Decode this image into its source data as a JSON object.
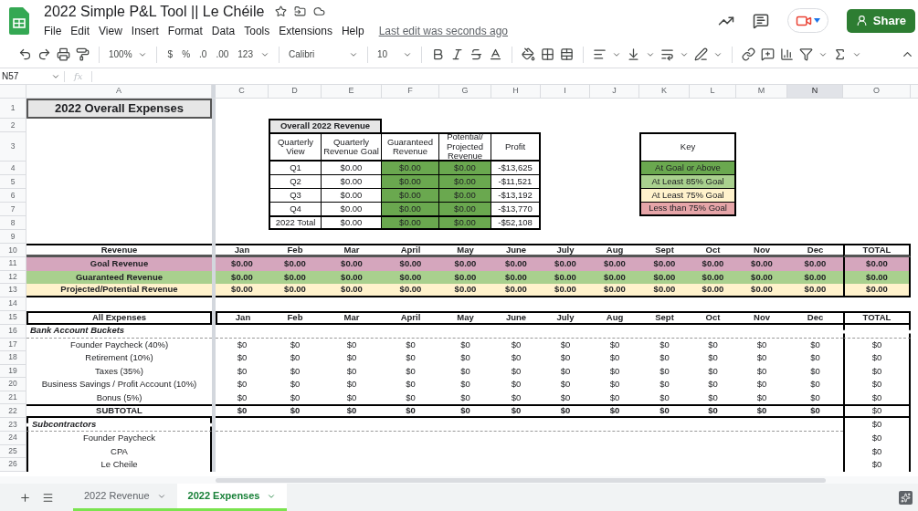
{
  "app": {
    "title": "2022 Simple P&L Tool || Le Chéile",
    "menu": [
      "File",
      "Edit",
      "View",
      "Insert",
      "Format",
      "Data",
      "Tools",
      "Extensions",
      "Help"
    ],
    "last_edit": "Last edit was seconds ago",
    "share": "Share"
  },
  "toolbar": {
    "zoom": "100%",
    "number_formats": [
      "$",
      "%",
      ".0",
      ".00",
      "123"
    ],
    "font": "Calibri",
    "font_size": "10"
  },
  "formula_bar": {
    "name_box": "N57",
    "fx": "fx"
  },
  "column_headers": [
    {
      "label": "A",
      "selected": false
    },
    {
      "label": "C",
      "selected": false
    },
    {
      "label": "D",
      "selected": false
    },
    {
      "label": "E",
      "selected": false
    },
    {
      "label": "F",
      "selected": false
    },
    {
      "label": "G",
      "selected": false
    },
    {
      "label": "H",
      "selected": false
    },
    {
      "label": "I",
      "selected": false
    },
    {
      "label": "J",
      "selected": false
    },
    {
      "label": "K",
      "selected": false
    },
    {
      "label": "L",
      "selected": false
    },
    {
      "label": "M",
      "selected": false
    },
    {
      "label": "N",
      "selected": true
    },
    {
      "label": "O",
      "selected": false
    }
  ],
  "row_numbers": [
    "1",
    "2",
    "3",
    "4",
    "5",
    "6",
    "7",
    "8",
    "9",
    "10",
    "11",
    "12",
    "13",
    "14",
    "15",
    "16",
    "17",
    "18",
    "19",
    "20",
    "21",
    "22",
    "23",
    "24",
    "25",
    "26"
  ],
  "sheet_title": "2022 Overall Expenses",
  "overall_revenue": {
    "title": "Overall 2022 Revenue",
    "columns": [
      {
        "label": "Quarterly View",
        "highlighted": false
      },
      {
        "label": "Quarterly Revenue Goal",
        "highlighted": false
      },
      {
        "label": "Guaranteed Revenue",
        "highlighted": true
      },
      {
        "label": "Potential/ Projected Revenue",
        "highlighted": true
      },
      {
        "label": "Profit",
        "highlighted": false
      }
    ],
    "rows": [
      [
        "Q1",
        "$0.00",
        "$0.00",
        "$0.00",
        "-$13,625"
      ],
      [
        "Q2",
        "$0.00",
        "$0.00",
        "$0.00",
        "-$11,521"
      ],
      [
        "Q3",
        "$0.00",
        "$0.00",
        "$0.00",
        "-$13,192"
      ],
      [
        "Q4",
        "$0.00",
        "$0.00",
        "$0.00",
        "-$13,770"
      ],
      [
        "2022 Total",
        "$0.00",
        "$0.00",
        "$0.00",
        "-$52,108"
      ]
    ]
  },
  "key": {
    "title": "Key",
    "items": [
      {
        "label": "At Goal or Above",
        "color": "#6aa84f"
      },
      {
        "label": "At Least 85% Goal",
        "color": "#a9d08e"
      },
      {
        "label": "At Least 75% Goal",
        "color": "#fff2cc"
      },
      {
        "label": "Less than 75% Goal",
        "color": "#e6a5a8"
      }
    ]
  },
  "revenue": {
    "label": "Revenue",
    "columns": [
      "Jan",
      "Feb",
      "Mar",
      "April",
      "May",
      "June",
      "July",
      "Aug",
      "Sept",
      "Oct",
      "Nov",
      "Dec",
      "TOTAL"
    ],
    "rows": [
      {
        "label": "Goal Revenue",
        "color": "#d5a6bd",
        "values": [
          "$0.00",
          "$0.00",
          "$0.00",
          "$0.00",
          "$0.00",
          "$0.00",
          "$0.00",
          "$0.00",
          "$0.00",
          "$0.00",
          "$0.00",
          "$0.00",
          "$0.00"
        ]
      },
      {
        "label": "Guaranteed Revenue",
        "color": "#a9d08e",
        "values": [
          "$0.00",
          "$0.00",
          "$0.00",
          "$0.00",
          "$0.00",
          "$0.00",
          "$0.00",
          "$0.00",
          "$0.00",
          "$0.00",
          "$0.00",
          "$0.00",
          "$0.00"
        ]
      },
      {
        "label": "Projected/Potential Revenue",
        "color": "#fff2cc",
        "values": [
          "$0.00",
          "$0.00",
          "$0.00",
          "$0.00",
          "$0.00",
          "$0.00",
          "$0.00",
          "$0.00",
          "$0.00",
          "$0.00",
          "$0.00",
          "$0.00",
          "$0.00"
        ]
      }
    ]
  },
  "expenses": {
    "label": "All Expenses",
    "columns": [
      "Jan",
      "Feb",
      "Mar",
      "April",
      "May",
      "June",
      "July",
      "Aug",
      "Sept",
      "Oct",
      "Nov",
      "Dec",
      "TOTAL"
    ],
    "bank_section": {
      "title": "Bank Account Buckets",
      "items": [
        {
          "label": "Founder Paycheck (40%)",
          "values": [
            "$0",
            "$0",
            "$0",
            "$0",
            "$0",
            "$0",
            "$0",
            "$0",
            "$0",
            "$0",
            "$0",
            "$0",
            "$0"
          ]
        },
        {
          "label": "Retirement (10%)",
          "values": [
            "$0",
            "$0",
            "$0",
            "$0",
            "$0",
            "$0",
            "$0",
            "$0",
            "$0",
            "$0",
            "$0",
            "$0",
            "$0"
          ]
        },
        {
          "label": "Taxes (35%)",
          "values": [
            "$0",
            "$0",
            "$0",
            "$0",
            "$0",
            "$0",
            "$0",
            "$0",
            "$0",
            "$0",
            "$0",
            "$0",
            "$0"
          ]
        },
        {
          "label": "Business Savings / Profit Account (10%)",
          "values": [
            "$0",
            "$0",
            "$0",
            "$0",
            "$0",
            "$0",
            "$0",
            "$0",
            "$0",
            "$0",
            "$0",
            "$0",
            "$0"
          ]
        },
        {
          "label": "Bonus (5%)",
          "values": [
            "$0",
            "$0",
            "$0",
            "$0",
            "$0",
            "$0",
            "$0",
            "$0",
            "$0",
            "$0",
            "$0",
            "$0",
            "$0"
          ]
        }
      ],
      "subtotal": {
        "label": "SUBTOTAL",
        "values": [
          "$0",
          "$0",
          "$0",
          "$0",
          "$0",
          "$0",
          "$0",
          "$0",
          "$0",
          "$0",
          "$0",
          "$0",
          "$0"
        ]
      }
    },
    "subcontractors": {
      "title": "Subcontractors",
      "total": "$0",
      "items": [
        {
          "label": "Founder Paycheck",
          "total": "$0"
        },
        {
          "label": "CPA",
          "total": "$0"
        },
        {
          "label": "Le Cheile",
          "total": "$0"
        }
      ]
    }
  },
  "sheet_tabs": [
    {
      "label": "2022 Revenue",
      "selected": false
    },
    {
      "label": "2022 Expenses",
      "selected": true
    }
  ]
}
